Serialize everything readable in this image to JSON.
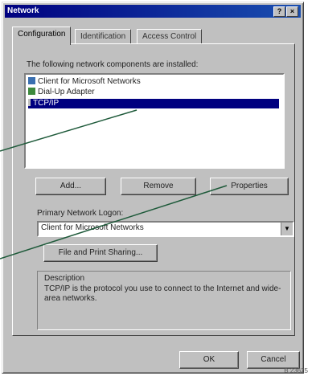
{
  "window": {
    "title": "Network",
    "help_glyph": "?",
    "close_glyph": "×"
  },
  "tabs": [
    {
      "label": "Configuration"
    },
    {
      "label": "Identification"
    },
    {
      "label": "Access Control"
    }
  ],
  "components": {
    "heading": "The following network components are installed:",
    "items": [
      {
        "label": "Client for Microsoft Networks",
        "icon": "client-icon",
        "selected": false
      },
      {
        "label": "Dial-Up Adapter",
        "icon": "adapter-icon",
        "selected": false
      },
      {
        "label": "TCP/IP",
        "icon": "protocol-icon",
        "selected": true
      }
    ]
  },
  "buttons": {
    "add": "Add...",
    "remove": "Remove",
    "properties": "Properties",
    "file_print_sharing": "File and Print Sharing...",
    "ok": "OK",
    "cancel": "Cancel"
  },
  "logon": {
    "label": "Primary Network Logon:",
    "value": "Client for Microsoft Networks"
  },
  "description": {
    "title": "Description",
    "text": "TCP/IP is the protocol you use to connect to the Internet and wide-area networks."
  },
  "figure_code": "B 23625",
  "colors": {
    "callout_line": "#1e5a3a",
    "selection": "#000080",
    "titlebar": "#000080"
  }
}
